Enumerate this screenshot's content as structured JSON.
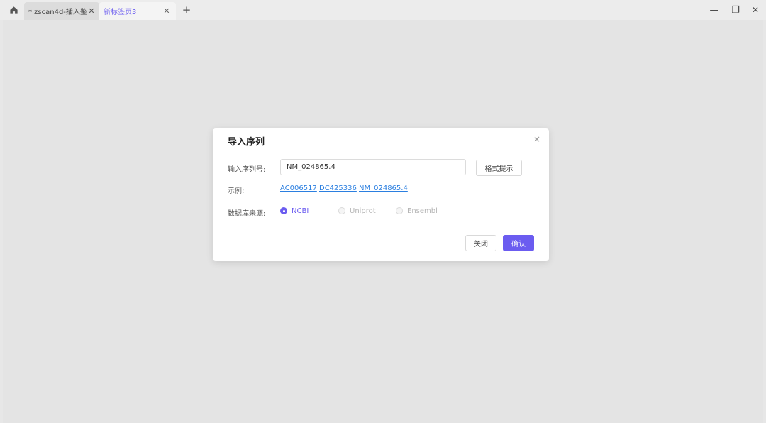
{
  "titlebar": {
    "tabs": [
      {
        "label": "* zscan4d-插入鉴...",
        "close": "✕",
        "active": false
      },
      {
        "label": "新标签页3",
        "close": "✕",
        "active": true
      }
    ],
    "new_tab": "+",
    "window_controls": {
      "minimize": "—",
      "restore": "❐",
      "close": "✕"
    },
    "icons": {
      "home": "home-icon"
    }
  },
  "dialog": {
    "title": "导入序列",
    "close": "×",
    "input_label": "输入序列号:",
    "input_value": "NM_024865.4",
    "hint_button": "格式提示",
    "example_label": "示例:",
    "examples": [
      "AC006517",
      "DC425336",
      "NM_024865.4"
    ],
    "source_label": "数据库来源:",
    "sources": [
      {
        "label": "NCBI",
        "checked": true
      },
      {
        "label": "Uniprot",
        "checked": false
      },
      {
        "label": "Ensembl",
        "checked": false
      }
    ],
    "cancel_button": "关闭",
    "confirm_button": "确认"
  },
  "colors": {
    "accent": "#6b5cf0",
    "link": "#2b7fe0",
    "page_bg": "#e4e4e4"
  }
}
